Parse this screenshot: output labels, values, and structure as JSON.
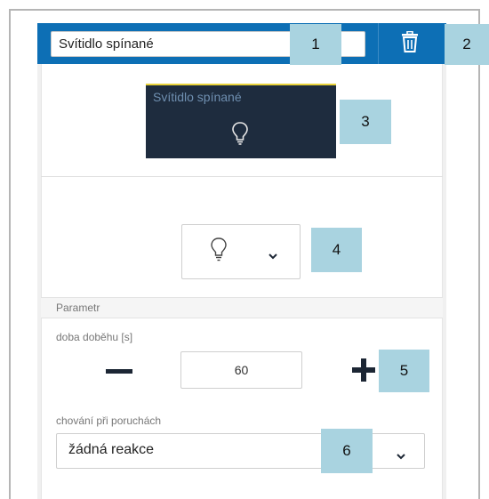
{
  "header": {
    "name_value": "Svítidlo spínané",
    "delete_icon": "trash-icon",
    "accent_color": "#0d6fb5"
  },
  "tile": {
    "title": "Svítidlo spínané",
    "icon": "lightbulb-icon"
  },
  "icon_selector": {
    "selected_icon": "lightbulb-icon",
    "dropdown_icon": "chevron-down-icon"
  },
  "parameters": {
    "section_label": "Parametr",
    "runtime": {
      "label": "doba doběhu [s]",
      "value": "60",
      "decrement_icon": "minus-icon",
      "increment_icon": "plus-icon"
    },
    "fault_behavior": {
      "label": "chování při poruchách",
      "selected": "žádná reakce",
      "dropdown_icon": "chevron-down-icon"
    }
  },
  "callouts": [
    "1",
    "2",
    "3",
    "4",
    "5",
    "6"
  ]
}
